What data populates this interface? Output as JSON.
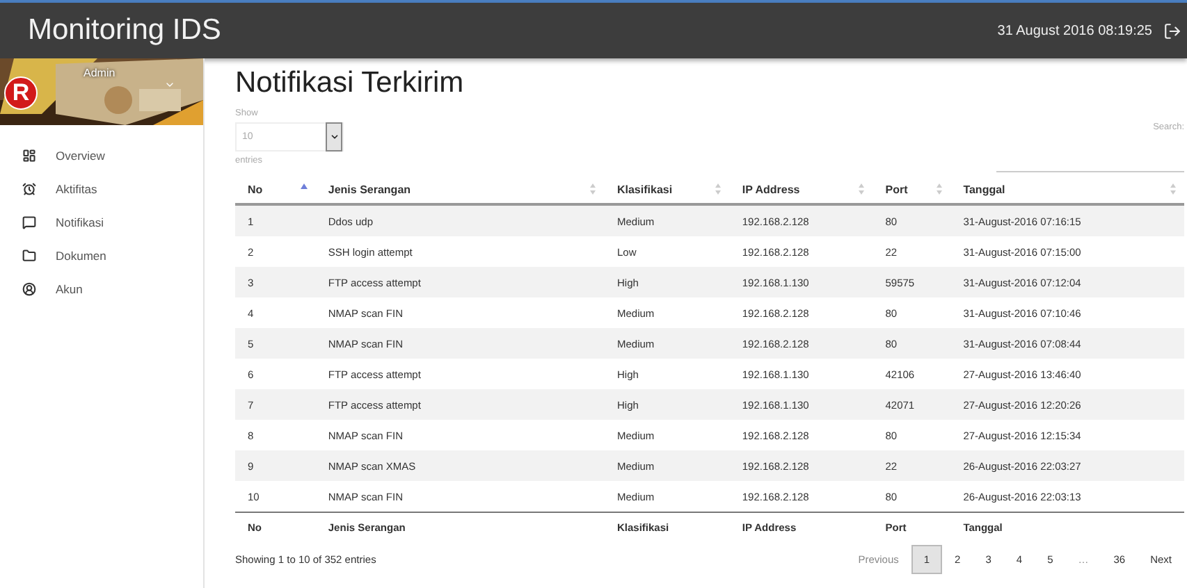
{
  "app_bar": {
    "title": "Monitoring IDS",
    "datetime": "31 August 2016 08:19:25"
  },
  "profile": {
    "avatar_letter": "R",
    "name": "Admin"
  },
  "sidebar": {
    "items": [
      {
        "label": "Overview"
      },
      {
        "label": "Aktifitas"
      },
      {
        "label": "Notifikasi"
      },
      {
        "label": "Dokumen"
      },
      {
        "label": "Akun"
      }
    ]
  },
  "page": {
    "title": "Notifikasi Terkirim"
  },
  "length_control": {
    "label_before": "Show",
    "value": "10",
    "label_after": "entries"
  },
  "search": {
    "label": "Search:"
  },
  "table": {
    "columns": [
      {
        "label": "No",
        "sorted": true
      },
      {
        "label": "Jenis Serangan",
        "sorted": false
      },
      {
        "label": "Klasifikasi",
        "sorted": false
      },
      {
        "label": "IP Address",
        "sorted": false
      },
      {
        "label": "Port",
        "sorted": false
      },
      {
        "label": "Tanggal",
        "sorted": false
      }
    ],
    "rows": [
      [
        "1",
        "Ddos udp",
        "Medium",
        "192.168.2.128",
        "80",
        "31-August-2016 07:16:15"
      ],
      [
        "2",
        "SSH login attempt",
        "Low",
        "192.168.2.128",
        "22",
        "31-August-2016 07:15:00"
      ],
      [
        "3",
        "FTP access attempt",
        "High",
        "192.168.1.130",
        "59575",
        "31-August-2016 07:12:04"
      ],
      [
        "4",
        "NMAP scan FIN",
        "Medium",
        "192.168.2.128",
        "80",
        "31-August-2016 07:10:46"
      ],
      [
        "5",
        "NMAP scan FIN",
        "Medium",
        "192.168.2.128",
        "80",
        "31-August-2016 07:08:44"
      ],
      [
        "6",
        "FTP access attempt",
        "High",
        "192.168.1.130",
        "42106",
        "27-August-2016 13:46:40"
      ],
      [
        "7",
        "FTP access attempt",
        "High",
        "192.168.1.130",
        "42071",
        "27-August-2016 12:20:26"
      ],
      [
        "8",
        "NMAP scan FIN",
        "Medium",
        "192.168.2.128",
        "80",
        "27-August-2016 12:15:34"
      ],
      [
        "9",
        "NMAP scan XMAS",
        "Medium",
        "192.168.2.128",
        "22",
        "26-August-2016 22:03:27"
      ],
      [
        "10",
        "NMAP scan FIN",
        "Medium",
        "192.168.2.128",
        "80",
        "26-August-2016 22:03:13"
      ]
    ],
    "footer_columns": [
      "No",
      "Jenis Serangan",
      "Klasifikasi",
      "IP Address",
      "Port",
      "Tanggal"
    ]
  },
  "info": "Showing 1 to 10 of 352 entries",
  "pagination": {
    "previous": {
      "label": "Previous",
      "disabled": true
    },
    "pages": [
      {
        "label": "1",
        "selected": true
      },
      {
        "label": "2",
        "selected": false
      },
      {
        "label": "3",
        "selected": false
      },
      {
        "label": "4",
        "selected": false
      },
      {
        "label": "5",
        "selected": false
      },
      {
        "label": "…",
        "kind": "ellipsis"
      },
      {
        "label": "36",
        "selected": false
      }
    ],
    "next": {
      "label": "Next",
      "disabled": false
    }
  }
}
